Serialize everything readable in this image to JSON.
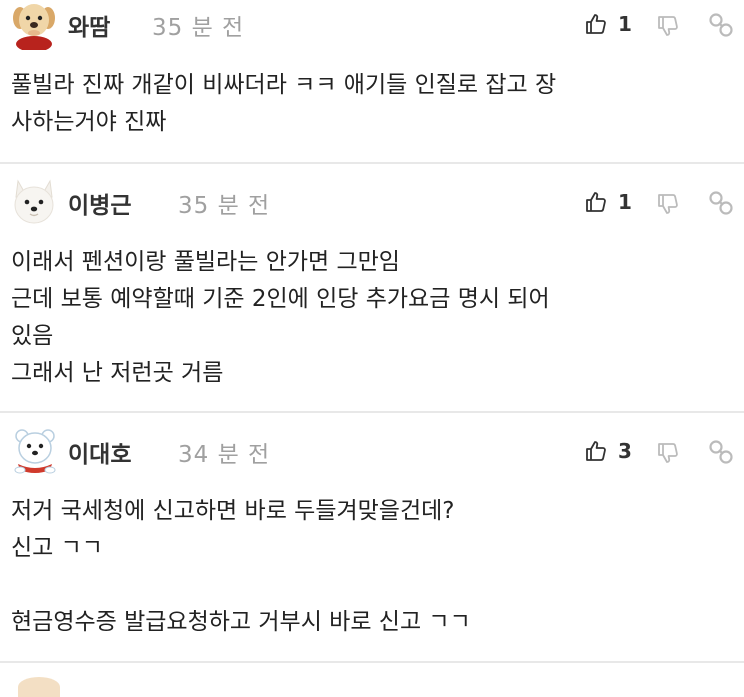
{
  "colors": {
    "text": "#222222",
    "name": "#333333",
    "time": "#a0a0a0",
    "icon": "#333333",
    "icon_muted": "#bbbbbb",
    "separator": "#e8e8e8"
  },
  "comments": [
    {
      "author": "와땀",
      "time": "35 분 전",
      "body": "풀빌라 진짜 개같이 비싸더라 ㅋㅋ 애기들 인질로 잡고 장\n사하는거야 진짜",
      "likes": "1",
      "avatar": "puppy-avatar"
    },
    {
      "author": "이병근",
      "time": "35 분 전",
      "body": "이래서 펜션이랑 풀빌라는 안가면 그만임\n근데 보통 예약할때 기준 2인에 인당 추가요금 명시 되어\n있음\n그래서 난 저런곳 거름",
      "likes": "1",
      "avatar": "white-dog-avatar"
    },
    {
      "author": "이대호",
      "time": "34 분 전",
      "body": "저거 국세청에 신고하면 바로 두들겨맞을건데?\n신고 ㄱㄱ\n\n현금영수증 발급요청하고 거부시 바로 신고 ㄱㄱ",
      "likes": "3",
      "avatar": "polar-bear-avatar"
    }
  ]
}
